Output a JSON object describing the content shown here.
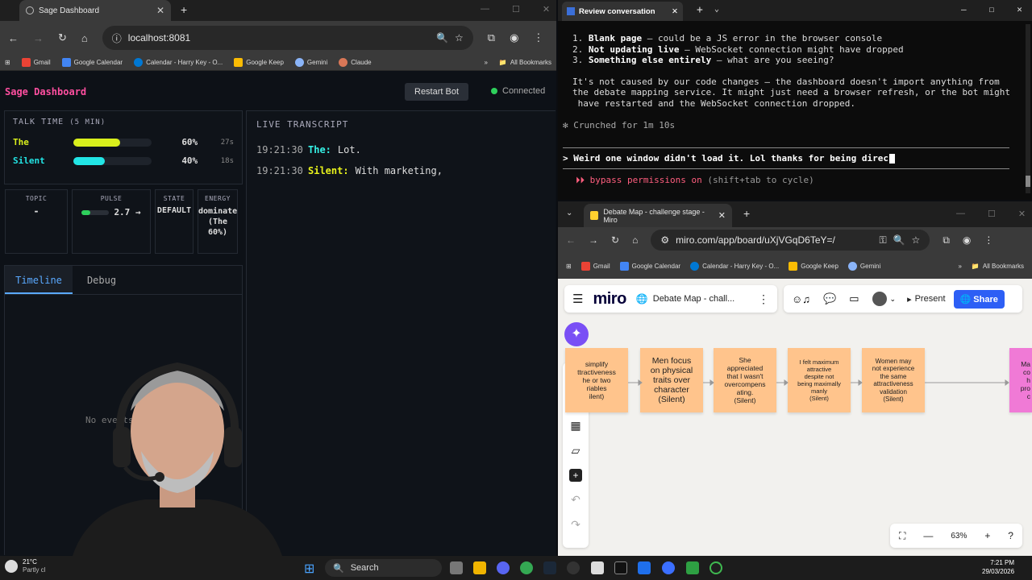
{
  "left_browser": {
    "tab_title": "Sage Dashboard",
    "url": "localhost:8081",
    "bookmarks": [
      "Gmail",
      "Google Calendar",
      "Calendar - Harry Key - O...",
      "Google Keep",
      "Gemini",
      "Claude"
    ],
    "all_bookmarks": "All Bookmarks"
  },
  "dashboard": {
    "title": "Sage Dashboard",
    "restart_label": "Restart Bot",
    "status": "Connected",
    "talk_time": {
      "title": "TALK TIME",
      "window": "(5 MIN)",
      "speakers": [
        {
          "name": "The",
          "pct_label": "60%",
          "secs": "27s",
          "fraction": 0.6,
          "color": "#d9ef1c"
        },
        {
          "name": "Silent",
          "pct_label": "40%",
          "secs": "18s",
          "fraction": 0.4,
          "color": "#22e5e5"
        }
      ]
    },
    "cards": {
      "topic": {
        "label": "TOPIC",
        "value": "-"
      },
      "pulse": {
        "label": "PULSE",
        "value": "2.7 →",
        "fraction": 0.3
      },
      "state": {
        "label": "STATE",
        "value": "DEFAULT"
      },
      "energy": {
        "label": "ENERGY",
        "value": "dominate",
        "sub1": "(The",
        "sub2": "60%)"
      }
    },
    "tabs": {
      "timeline": "Timeline",
      "debug": "Debug"
    },
    "no_events": "No events",
    "transcript": {
      "title": "LIVE TRANSCRIPT",
      "lines": [
        {
          "time": "19:21:30",
          "speaker": "The:",
          "text": "Lot.",
          "color": "#36f2e6"
        },
        {
          "time": "19:21:30",
          "speaker": "Silent:",
          "text": "With marketing,",
          "color": "#e8f21c"
        }
      ]
    }
  },
  "terminal": {
    "tab_title": "Review conversation",
    "items": [
      {
        "num": "1.",
        "bold": "Blank page",
        "rest": " — could be a JS error in the browser console"
      },
      {
        "num": "2.",
        "bold": "Not updating live",
        "rest": " — WebSocket connection might have dropped"
      },
      {
        "num": "3.",
        "bold": "Something else entirely",
        "rest": " — what are you seeing?"
      }
    ],
    "para1": "It's not caused by our code changes — the dashboard doesn't import anything from",
    "para2": "the debate mapping service. It might just need a browser refresh, or the bot might",
    "para3": " have restarted and the WebSocket connection dropped.",
    "crunched": "Crunched for 1m 10s",
    "input": "Weird one window didn't load it. Lol thanks for being direc",
    "bypass": "bypass permissions on",
    "bypass_hint": "(shift+tab to cycle)"
  },
  "miro_browser": {
    "tab_title": "Debate Map - challenge stage - Miro",
    "url": "miro.com/app/board/uXjVGqD6TeY=/",
    "bookmarks": [
      "Gmail",
      "Google Calendar",
      "Calendar - Harry Key - O...",
      "Google Keep",
      "Gemini"
    ],
    "all_bookmarks": "All Bookmarks",
    "logo": "miro",
    "board_name": "Debate Map - chall...",
    "present": "Present",
    "share": "Share",
    "zoom": "63%",
    "stickies": [
      {
        "l1": "simplify",
        "l2": "ttractiveness",
        "l3": "he or two",
        "l4": "riables",
        "tag": "ilent)"
      },
      {
        "l1": "Men focus",
        "l2": "on physical",
        "l3": "traits over",
        "l4": "character",
        "tag": "(Silent)"
      },
      {
        "l1": "She",
        "l2": "appreciated",
        "l3": "that I wasn't",
        "l4": "overcompens ating.",
        "tag": "(Silent)"
      },
      {
        "l1": "I felt maximum",
        "l2": "attractive",
        "l3": "despite not",
        "l4": "being maximally manly",
        "tag": "(Silent)"
      },
      {
        "l1": "Women may",
        "l2": "not experience",
        "l3": "the same",
        "l4": "attractiveness validation",
        "tag": "(Silent)"
      }
    ],
    "pink_sticky": [
      "Ma",
      "co",
      "h",
      "pro",
      "c"
    ]
  },
  "taskbar": {
    "temp": "21°C",
    "weather": "Partly cl",
    "search": "Search",
    "time": "7:21 PM",
    "date": "29/03/2026"
  }
}
